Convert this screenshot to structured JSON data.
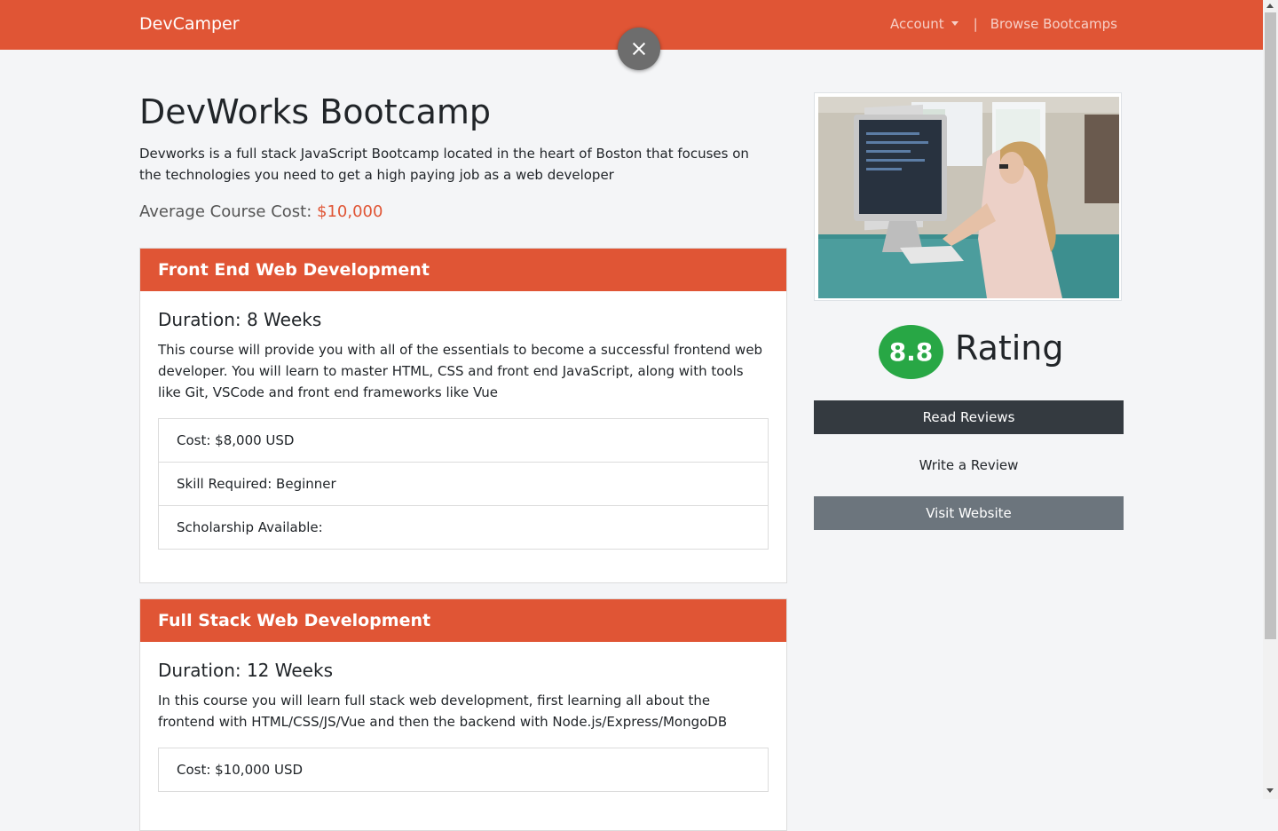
{
  "navbar": {
    "brand": "DevCamper",
    "account_label": "Account",
    "separator": "|",
    "browse_label": "Browse Bootcamps"
  },
  "bootcamp": {
    "title": "DevWorks Bootcamp",
    "description": "Devworks is a full stack JavaScript Bootcamp located in the heart of Boston that focuses on the technologies you need to get a high paying job as a web developer",
    "avg_cost_label": "Average Course Cost:",
    "avg_cost_value": "$10,000"
  },
  "courses": [
    {
      "title": "Front End Web Development",
      "duration": "Duration: 8 Weeks",
      "description": "This course will provide you with all of the essentials to become a successful frontend web developer. You will learn to master HTML, CSS and front end JavaScript, along with tools like Git, VSCode and front end frameworks like Vue",
      "details": [
        "Cost: $8,000 USD",
        "Skill Required: Beginner",
        "Scholarship Available:"
      ]
    },
    {
      "title": "Full Stack Web Development",
      "duration": "Duration: 12 Weeks",
      "description": "In this course you will learn full stack web development, first learning all about the frontend with HTML/CSS/JS/Vue and then the backend with Node.js/Express/MongoDB",
      "details": [
        "Cost: $10,000 USD"
      ]
    }
  ],
  "sidebar": {
    "rating_value": "8.8",
    "rating_label": "Rating",
    "read_reviews": "Read Reviews",
    "write_review": "Write a Review",
    "visit_website": "Visit Website"
  },
  "icons": {
    "close": "close-icon",
    "caret": "chevron-down-icon"
  },
  "colors": {
    "brand": "#e05535",
    "rating": "#28a745",
    "dark_button": "#343a40",
    "secondary_button": "#6c757d"
  }
}
